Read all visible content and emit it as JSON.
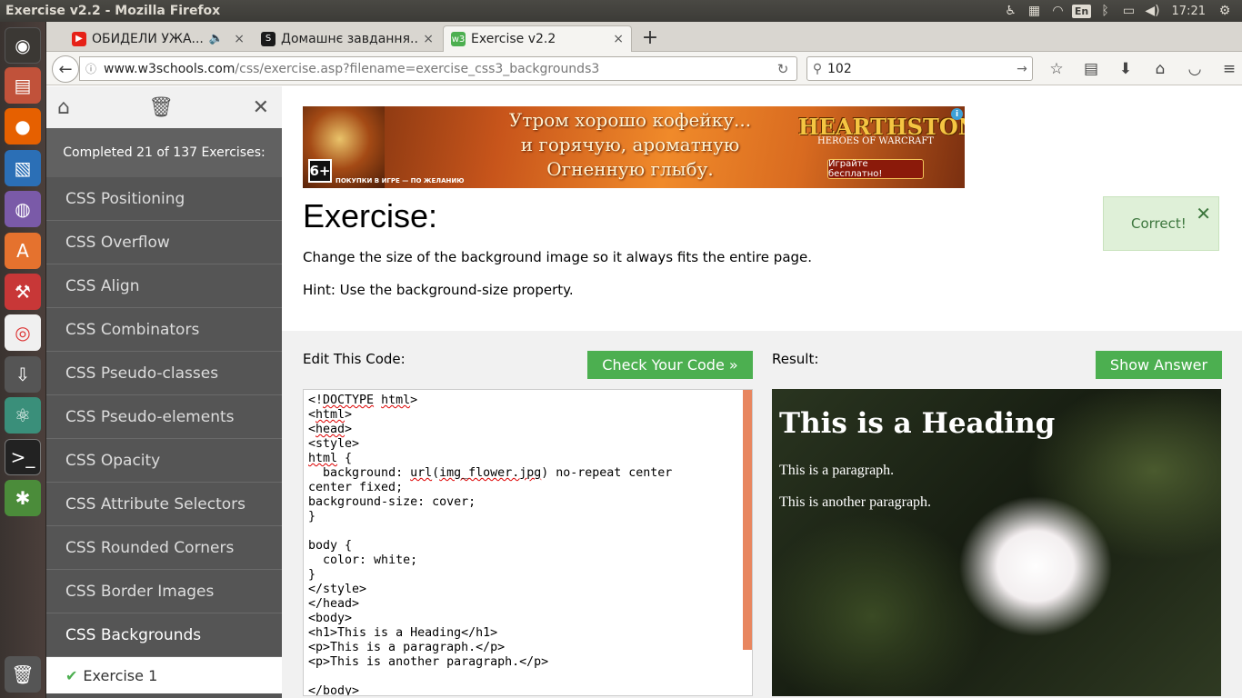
{
  "os": {
    "window_title": "Exercise v2.2 - Mozilla Firefox",
    "keyboard": "En",
    "clock": "17:21"
  },
  "tabs": [
    {
      "label": "ОБИДЕЛИ УЖА...",
      "icon": "youtube-icon",
      "color": "#e62117"
    },
    {
      "label": "Домашнє завдання...",
      "icon": "skype-icon",
      "color": "#1a1a1a"
    },
    {
      "label": "Exercise v2.2",
      "icon": "w3schools-icon",
      "color": "#4caf50"
    }
  ],
  "nav": {
    "url_host": "www.w3schools.com",
    "url_path": "/css/exercise.asp?filename=exercise_css3_backgrounds3",
    "search_value": "102"
  },
  "sidebar": {
    "progress": "Completed 21 of 137 Exercises:",
    "items": [
      {
        "label": "CSS Positioning"
      },
      {
        "label": "CSS Overflow"
      },
      {
        "label": "CSS Align"
      },
      {
        "label": "CSS Combinators"
      },
      {
        "label": "CSS Pseudo-classes"
      },
      {
        "label": "CSS Pseudo-elements"
      },
      {
        "label": "CSS Opacity"
      },
      {
        "label": "CSS Attribute Selectors"
      },
      {
        "label": "CSS Rounded Corners"
      },
      {
        "label": "CSS Border Images"
      },
      {
        "label": "CSS Backgrounds"
      }
    ],
    "sub_item": "Exercise 1"
  },
  "ad": {
    "line1": "Утром хорошо кофейку...",
    "line2": "и горячую, ароматную",
    "line3": "Огненную глыбу.",
    "age": "6+",
    "fine_print": "ПОКУПКИ В ИГРЕ — ПО ЖЕЛАНИЮ",
    "logo": "HEARTHSTONE",
    "logo_sub": "HEROES OF WARCRAFT",
    "button": "Играйте бесплатно!"
  },
  "exercise": {
    "title": "Exercise:",
    "description": "Change the size of the background image so it always fits the entire page.",
    "hint": "Hint: Use the background-size property.",
    "correct": "Correct!"
  },
  "work": {
    "edit_label": "Edit This Code:",
    "check_button": "Check Your Code »",
    "result_label": "Result:",
    "answer_button": "Show Answer"
  },
  "result": {
    "heading": "This is a Heading",
    "p1": "This is a paragraph.",
    "p2": "This is another paragraph."
  },
  "colors": {
    "accent_green": "#4caf50",
    "sidebar_bg": "#555555"
  }
}
